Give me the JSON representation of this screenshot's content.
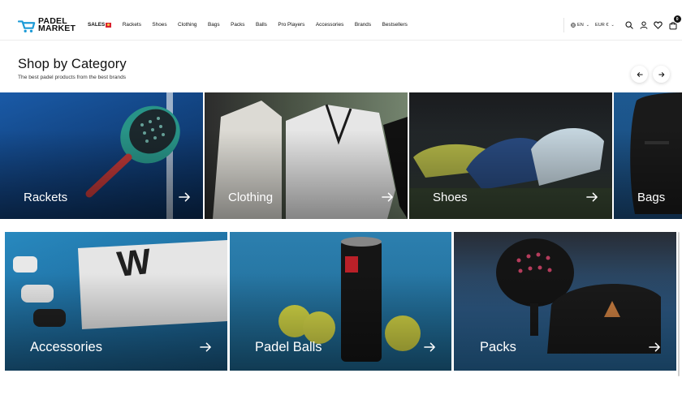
{
  "brand": {
    "line1": "PADEL",
    "line2": "MARKET"
  },
  "nav": {
    "items": [
      {
        "label": "SALES",
        "name": "nav-sales"
      },
      {
        "label": "Rackets",
        "name": "nav-rackets"
      },
      {
        "label": "Shoes",
        "name": "nav-shoes"
      },
      {
        "label": "Clothing",
        "name": "nav-clothing"
      },
      {
        "label": "Bags",
        "name": "nav-bags"
      },
      {
        "label": "Packs",
        "name": "nav-packs"
      },
      {
        "label": "Balls",
        "name": "nav-balls"
      },
      {
        "label": "Pro Players",
        "name": "nav-pro-players"
      },
      {
        "label": "Accessories",
        "name": "nav-accessories"
      },
      {
        "label": "Brands",
        "name": "nav-brands"
      },
      {
        "label": "Bestsellers",
        "name": "nav-bestsellers"
      }
    ]
  },
  "utility": {
    "language": "EN",
    "currency": "EUR €",
    "cart_count": "0"
  },
  "section": {
    "title": "Shop by Category",
    "subtitle": "The best padel products from the best brands"
  },
  "categories_row1": [
    {
      "label": "Rackets",
      "icon": "racket"
    },
    {
      "label": "Clothing",
      "icon": "clothing"
    },
    {
      "label": "Shoes",
      "icon": "shoes"
    },
    {
      "label": "Bags",
      "icon": "bag"
    }
  ],
  "categories_row2": [
    {
      "label": "Accessories",
      "icon": "overgrip"
    },
    {
      "label": "Padel Balls",
      "icon": "ball-tube"
    },
    {
      "label": "Packs",
      "icon": "racket-bag"
    }
  ],
  "colors": {
    "accent": "#1d9bd7",
    "text": "#111111",
    "sales_flag": "#d9232e"
  }
}
